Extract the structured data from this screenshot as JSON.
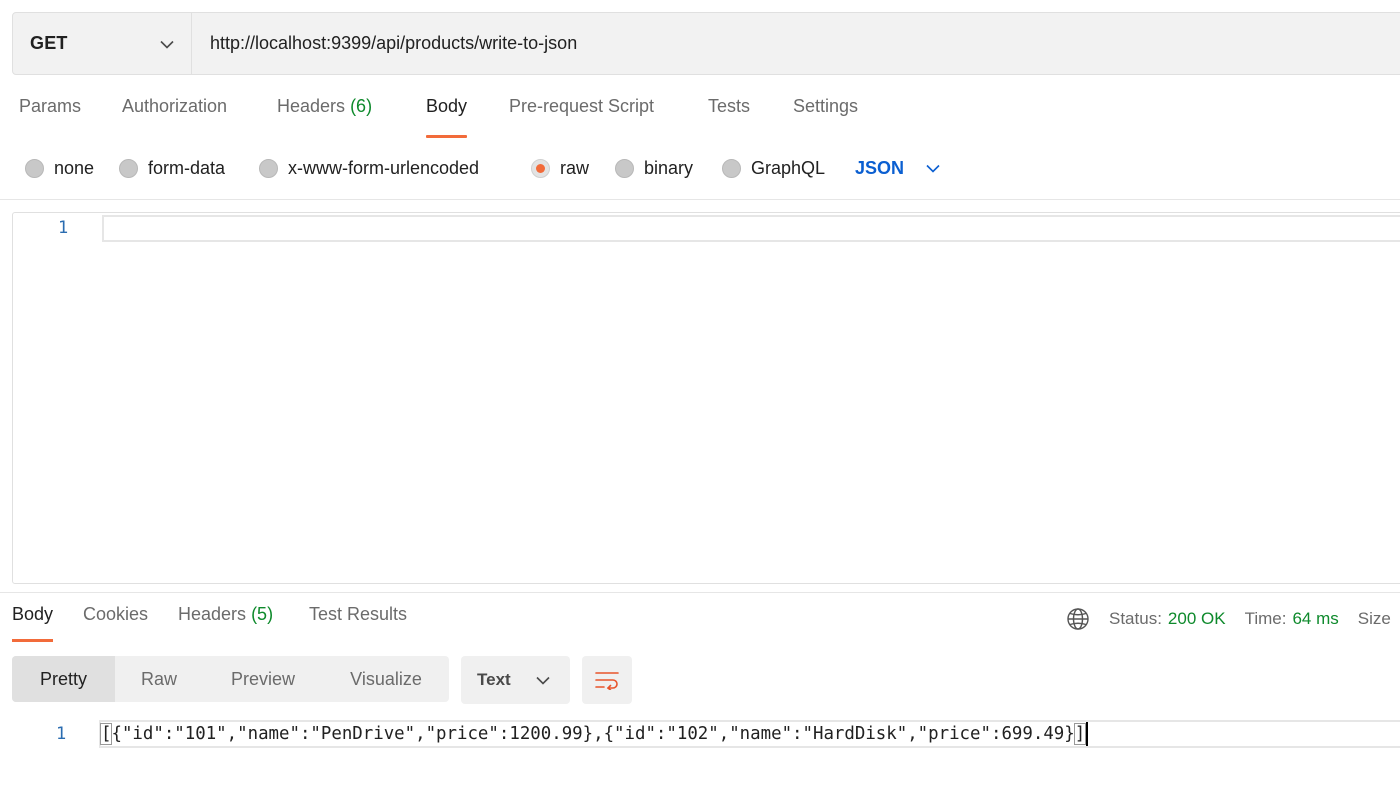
{
  "request": {
    "method": "GET",
    "url": "http://localhost:9399/api/products/write-to-json"
  },
  "request_tabs": [
    {
      "label": "Params",
      "count": ""
    },
    {
      "label": "Authorization",
      "count": ""
    },
    {
      "label": "Headers",
      "count": "(6)"
    },
    {
      "label": "Body",
      "count": "",
      "active": true
    },
    {
      "label": "Pre-request Script",
      "count": ""
    },
    {
      "label": "Tests",
      "count": ""
    },
    {
      "label": "Settings",
      "count": ""
    }
  ],
  "body_types": [
    {
      "label": "none",
      "selected": false
    },
    {
      "label": "form-data",
      "selected": false
    },
    {
      "label": "x-www-form-urlencoded",
      "selected": false
    },
    {
      "label": "raw",
      "selected": true
    },
    {
      "label": "binary",
      "selected": false
    },
    {
      "label": "GraphQL",
      "selected": false
    }
  ],
  "raw_format": "JSON",
  "editor": {
    "line_number": "1",
    "content": ""
  },
  "response_tabs": [
    {
      "label": "Body",
      "count": "",
      "active": true
    },
    {
      "label": "Cookies",
      "count": ""
    },
    {
      "label": "Headers",
      "count": "(5)"
    },
    {
      "label": "Test Results",
      "count": ""
    }
  ],
  "response_meta": {
    "status_label": "Status:",
    "status_value": "200 OK",
    "time_label": "Time:",
    "time_value": "64 ms",
    "size_label": "Size"
  },
  "view_modes": [
    "Pretty",
    "Raw",
    "Preview",
    "Visualize"
  ],
  "active_view_mode": "Pretty",
  "response_format": "Text",
  "response_body": {
    "line_number": "1",
    "open_bracket": "[",
    "text": "{\"id\":\"101\",\"name\":\"PenDrive\",\"price\":1200.99},{\"id\":\"102\",\"name\":\"HardDisk\",\"price\":699.49}",
    "close_bracket": "]"
  },
  "colors": {
    "accent": "#f26b3a",
    "count_green": "#0e8a2c",
    "json_blue": "#0b5fd1",
    "line_number_blue": "#2a6cb0"
  },
  "icons": {
    "method_dropdown": "chevron-down-icon",
    "format_dropdown": "chevron-down-icon",
    "network": "globe-icon",
    "wrap": "word-wrap-icon"
  }
}
